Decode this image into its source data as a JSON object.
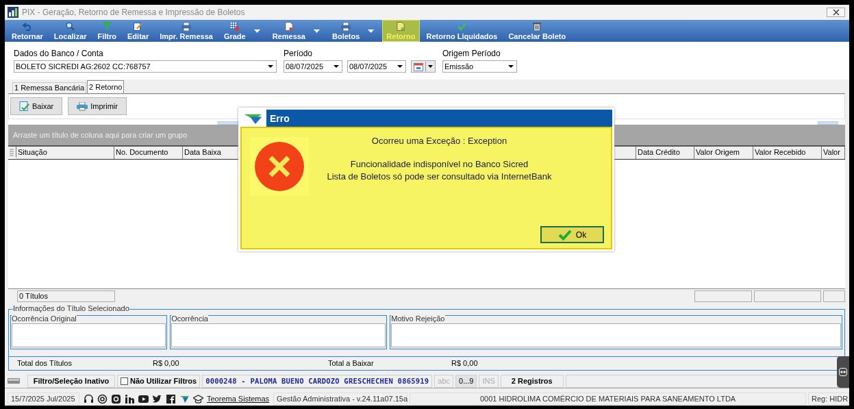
{
  "window": {
    "title": "PIX - Geração, Retorno de Remessa e Impressão de Boletos"
  },
  "toolbar": [
    {
      "label": "Retornar",
      "dropdown": false,
      "selected": false
    },
    {
      "label": "Localizar",
      "dropdown": false,
      "selected": false
    },
    {
      "label": "Filtro",
      "dropdown": false,
      "selected": false
    },
    {
      "label": "Editar",
      "dropdown": false,
      "selected": false
    },
    {
      "label": "Impr. Remessa",
      "dropdown": false,
      "selected": false
    },
    {
      "label": "Grade",
      "dropdown": true,
      "selected": false
    },
    {
      "label": "Remessa",
      "dropdown": true,
      "selected": false
    },
    {
      "label": "Boletos",
      "dropdown": true,
      "selected": false
    },
    {
      "label": "Retorno",
      "dropdown": false,
      "selected": true
    },
    {
      "label": "Retorno Liquidados",
      "dropdown": false,
      "selected": false
    },
    {
      "label": "Cancelar Boleto",
      "dropdown": false,
      "selected": false
    }
  ],
  "form": {
    "bank_account": {
      "label": "Dados do Banco / Conta",
      "value": "BOLETO SICREDI AG:2602 CC:768757"
    },
    "period": {
      "label": "Período",
      "start": "08/07/2025",
      "end": "08/07/2025"
    },
    "period_origin": {
      "label": "Origem Período",
      "value": "Emissão"
    }
  },
  "tabs": [
    {
      "label": "1 Remessa Bancária",
      "selected": false
    },
    {
      "label": "2 Retorno",
      "selected": true
    }
  ],
  "actions": [
    {
      "label": "Baixar"
    },
    {
      "label": "Imprimir"
    }
  ],
  "grid": {
    "group_hint": "Arraste um título de coluna aqui para criar um grupo",
    "columns_left": [
      "Situação",
      "No. Documento",
      "Data Baixa"
    ],
    "columns_right": [
      "Data Crédito",
      "Valor Origem",
      "Valor Recebido",
      "Valor"
    ],
    "count": "0 Títulos"
  },
  "info": {
    "title": "Informações do Título Selecionado",
    "fields": [
      {
        "label": "Ocorrência Original"
      },
      {
        "label": "Ocorrência"
      },
      {
        "label": "Motivo Rejeição"
      }
    ]
  },
  "totals": [
    {
      "label": "Total dos Títulos",
      "value": "R$ 0,00"
    },
    {
      "label": "Total a Baixar",
      "value": "R$ 0,00"
    }
  ],
  "status_bar": {
    "filter_state": "Filtro/Seleção Inativo",
    "no_filters": {
      "label": "Não Utilizar Filtros",
      "checked": false
    },
    "record": "0000248 - PALOMA BUENO CARDOZO GRESCHECHEN 0865919",
    "indicators": [
      {
        "label": "abc",
        "active": false
      },
      {
        "label": "0...9",
        "active": true
      },
      {
        "label": "INS",
        "active": false
      }
    ],
    "count": "2 Registros"
  },
  "footer_bar": {
    "date": "15/7/2025 Jul/2025",
    "link": "Teorema Sistemas",
    "product": "Gestão Administrativa - v.24.11a07.15a",
    "company": "0001 HIDROLIMA COMÉRCIO DE MATERIAIS PARA SANEAMENTO LTDA",
    "registration": "Reg: HIDR"
  },
  "dialog": {
    "title": "Erro",
    "heading": "Ocorreu uma Exceção : Exception",
    "lines": [
      "Funcionalidade indisponível no Banco Sicred",
      "Lista de Boletos só pode ser consultado via InternetBank"
    ],
    "button": "Ok"
  }
}
